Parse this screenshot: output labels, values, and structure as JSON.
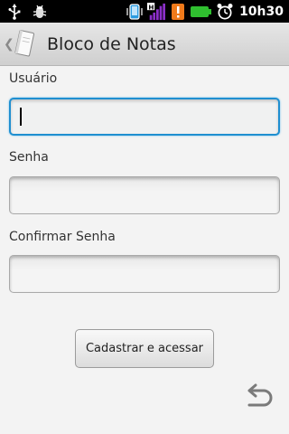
{
  "statusbar": {
    "icons_left": [
      "usb-icon",
      "debug-bug-icon"
    ],
    "icons_right": [
      "phone-sync-icon",
      "signal-strength-icon",
      "alert-icon",
      "battery-icon",
      "alarm-clock-icon"
    ],
    "network_type": "H",
    "time": "10h30"
  },
  "titlebar": {
    "app_icon": "notepad-icon",
    "title": "Bloco de Notas"
  },
  "form": {
    "usuario_label": "Usuário",
    "usuario_value": "",
    "senha_label": "Senha",
    "senha_value": "",
    "confirmar_label": "Confirmar Senha",
    "confirmar_value": ""
  },
  "actions": {
    "submit_label": "Cadastrar e acessar",
    "back_icon": "back-arrow-icon"
  },
  "colors": {
    "focus_border": "#1f8fd0",
    "background": "#f3f3f3",
    "statusbar": "#000000"
  }
}
